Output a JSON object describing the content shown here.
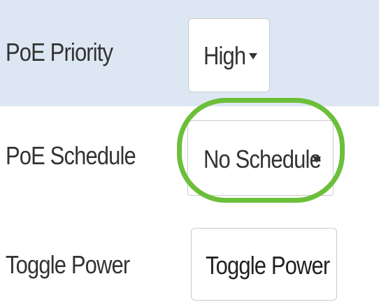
{
  "poe_priority": {
    "label": "PoE Priority",
    "selected": "High"
  },
  "poe_schedule": {
    "label": "PoE Schedule",
    "selected": "No Schedule",
    "highlight_color": "#6cbf3a"
  },
  "toggle_power": {
    "label": "Toggle Power",
    "button_label": "Toggle Power"
  },
  "colors": {
    "highlight_row": "#dde7f3",
    "text": "#333333",
    "border": "#cccccc"
  },
  "icons": {
    "dropdown_caret": "caret-down-icon"
  }
}
